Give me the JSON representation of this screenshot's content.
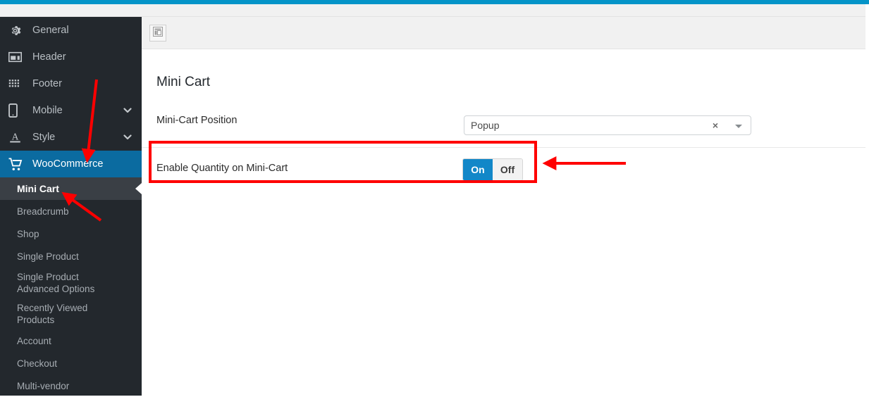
{
  "theme": {
    "accent_bar_color": "#0494c8",
    "sidebar_bg": "#23282d",
    "active_item_bg": "#0b6ba0",
    "toggle_on_color": "#1287c8",
    "annotation_color": "#ff0000"
  },
  "sidebar": {
    "items": [
      {
        "label": "General",
        "icon": "gear-icon",
        "active": false,
        "expandable": false
      },
      {
        "label": "Header",
        "icon": "header-layout-icon",
        "active": false,
        "expandable": false
      },
      {
        "label": "Footer",
        "icon": "footer-grid-icon",
        "active": false,
        "expandable": false
      },
      {
        "label": "Mobile",
        "icon": "mobile-phone-icon",
        "active": false,
        "expandable": true
      },
      {
        "label": "Style",
        "icon": "typography-a-icon",
        "active": false,
        "expandable": true
      },
      {
        "label": "WooCommerce",
        "icon": "shopping-cart-icon",
        "active": true,
        "expandable": false
      }
    ],
    "sub_items": [
      {
        "label": "Mini Cart",
        "current": true
      },
      {
        "label": "Breadcrumb",
        "current": false
      },
      {
        "label": "Shop",
        "current": false
      },
      {
        "label": "Single Product",
        "current": false
      },
      {
        "label": "Single Product Advanced Options",
        "current": false
      },
      {
        "label": "Recently Viewed Products",
        "current": false
      },
      {
        "label": "Account",
        "current": false
      },
      {
        "label": "Checkout",
        "current": false
      },
      {
        "label": "Multi-vendor",
        "current": false
      }
    ]
  },
  "toolbar": {
    "layout_toggle_icon": "panel-layout-icon"
  },
  "main": {
    "page_title": "Mini Cart",
    "position_field": {
      "label": "Mini-Cart Position",
      "selected_value": "Popup",
      "clear_glyph": "×",
      "dropdown_icon": "chevron-down-icon"
    },
    "quantity_field": {
      "label": "Enable Quantity on Mini-Cart",
      "on_label": "On",
      "off_label": "Off",
      "selected": "On"
    }
  },
  "annotations": {
    "highlight_box_label": "highlight around Enable Quantity on Mini-Cart row",
    "arrows": [
      {
        "name": "arrow-to-woocommerce",
        "direction": "down-left"
      },
      {
        "name": "arrow-to-mini-cart",
        "direction": "up-left"
      },
      {
        "name": "arrow-to-toggle",
        "direction": "left"
      }
    ]
  }
}
